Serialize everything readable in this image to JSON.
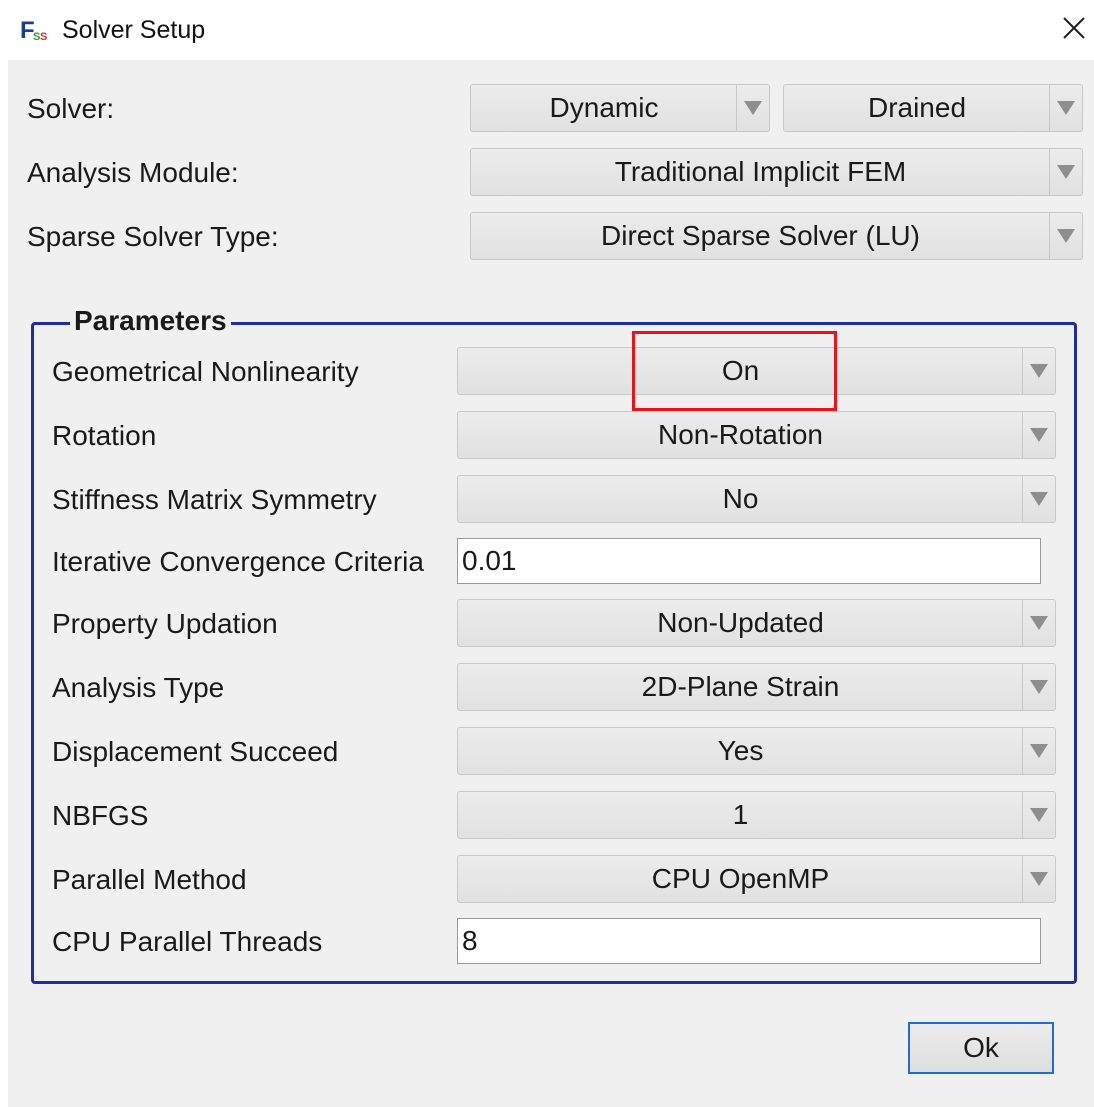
{
  "window": {
    "title": "Solver Setup",
    "icon_text": "FSS",
    "close_label": "×"
  },
  "top": {
    "solver_label": "Solver:",
    "solver_values": [
      "Dynamic",
      "Drained"
    ],
    "analysis_module_label": "Analysis Module:",
    "analysis_module_value": "Traditional Implicit FEM",
    "sparse_solver_label": "Sparse Solver Type:",
    "sparse_solver_value": "Direct Sparse Solver (LU)"
  },
  "parameters": {
    "title": "Parameters",
    "rows": [
      {
        "label": "Geometrical Nonlinearity",
        "value": "On"
      },
      {
        "label": "Rotation",
        "value": "Non-Rotation"
      },
      {
        "label": "Stiffness Matrix Symmetry",
        "value": "No"
      },
      {
        "label": "Iterative Convergence Criteria",
        "value": "0.01"
      },
      {
        "label": "Property Updation",
        "value": "Non-Updated"
      },
      {
        "label": "Analysis Type",
        "value": "2D-Plane Strain"
      },
      {
        "label": "Displacement Succeed",
        "value": "Yes"
      },
      {
        "label": "NBFGS",
        "value": "1"
      },
      {
        "label": "Parallel Method",
        "value": "CPU OpenMP"
      },
      {
        "label": "CPU Parallel Threads",
        "value": "8"
      }
    ]
  },
  "buttons": {
    "ok": "Ok"
  },
  "colors": {
    "group_border": "#1f2f9f",
    "highlight": "#e8141a",
    "ok_border": "#1f6fd2",
    "client_bg": "#f0f0f0"
  },
  "icons": {
    "app": "fss-logo-icon",
    "close": "close-icon",
    "dropdown": "chevron-down-icon"
  }
}
